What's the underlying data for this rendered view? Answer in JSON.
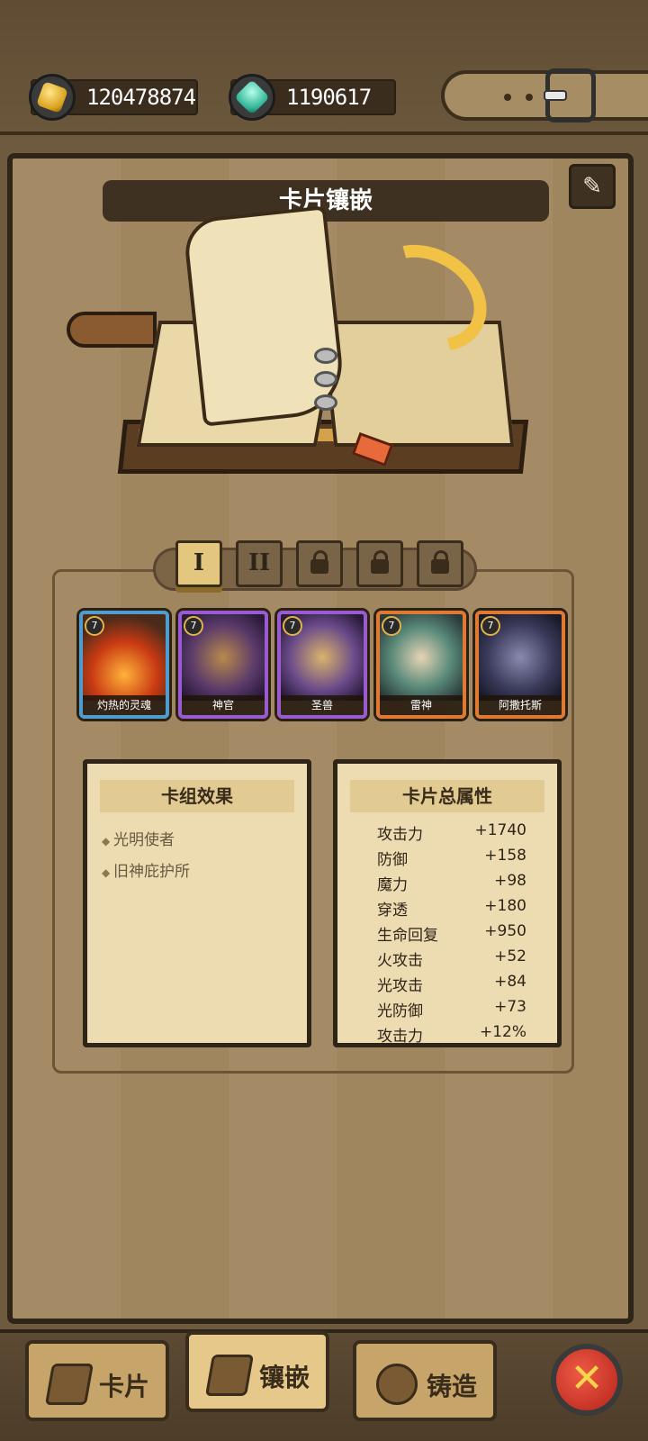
{
  "resources": {
    "gold": {
      "icon": "gold-icon",
      "value": "120478874"
    },
    "gems": {
      "icon": "gem-icon",
      "value": "1190617"
    }
  },
  "panel": {
    "title": "卡片镶嵌",
    "edit_icon": "brush-icon"
  },
  "deck_tabs": [
    {
      "label": "I",
      "state": "active"
    },
    {
      "label": "II",
      "state": "unlocked"
    },
    {
      "label": "",
      "state": "locked"
    },
    {
      "label": "",
      "state": "locked"
    },
    {
      "label": "",
      "state": "locked"
    }
  ],
  "cards": [
    {
      "name": "灼热的灵魂",
      "level": "7",
      "rarity": "blue"
    },
    {
      "name": "神官",
      "level": "7",
      "rarity": "purple"
    },
    {
      "name": "圣兽",
      "level": "7",
      "rarity": "purple"
    },
    {
      "name": "雷神",
      "level": "7",
      "rarity": "orange"
    },
    {
      "name": "阿撒托斯",
      "level": "7",
      "rarity": "orange"
    }
  ],
  "deck_effects": {
    "title": "卡组效果",
    "items": [
      "光明使者",
      "旧神庇护所"
    ]
  },
  "total_stats": {
    "title": "卡片总属性",
    "rows": [
      {
        "label": "攻击力",
        "value": "+1740"
      },
      {
        "label": "防御",
        "value": "+158"
      },
      {
        "label": "魔力",
        "value": "+98"
      },
      {
        "label": "穿透",
        "value": "+180"
      },
      {
        "label": "生命回复",
        "value": "+950"
      },
      {
        "label": "火攻击",
        "value": "+52"
      },
      {
        "label": "光攻击",
        "value": "+84"
      },
      {
        "label": "光防御",
        "value": "+73"
      },
      {
        "label": "攻击力",
        "value": "+12%"
      }
    ]
  },
  "nav": {
    "cards": "卡片",
    "inlay": "镶嵌",
    "forge": "铸造",
    "active": "inlay"
  },
  "colors": {
    "rarity_blue": "#4f9dd0",
    "rarity_purple": "#9a5ad0",
    "rarity_orange": "#e07a32",
    "close_red": "#d23a2a"
  }
}
